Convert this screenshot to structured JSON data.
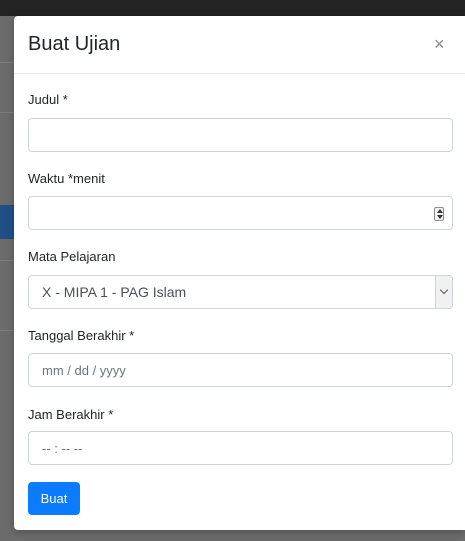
{
  "modal": {
    "title": "Buat Ujian",
    "close_symbol": "×"
  },
  "form": {
    "judul": {
      "label": "Judul *",
      "value": ""
    },
    "waktu": {
      "label": "Waktu *menit",
      "value": ""
    },
    "mata_pelajaran": {
      "label": "Mata Pelajaran",
      "selected": "X - MIPA 1 - PAG Islam"
    },
    "tanggal": {
      "label": "Tanggal Berakhir *",
      "placeholder": "mm / dd / yyyy"
    },
    "jam": {
      "label": "Jam Berakhir *",
      "placeholder": "-- : --  --"
    }
  },
  "actions": {
    "submit_label": "Buat"
  },
  "colors": {
    "primary": "#0b7bff",
    "backdrop": "#6b6b6b"
  }
}
